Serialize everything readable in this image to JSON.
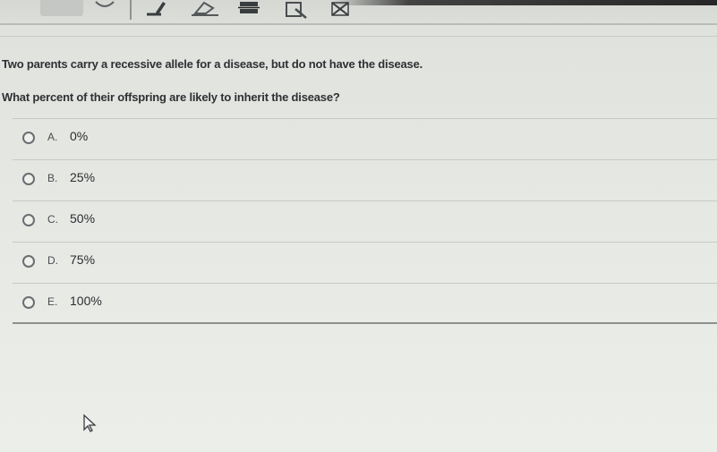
{
  "toolbar": {
    "icons": [
      "toolbar-tab",
      "chevron-down-icon",
      "highlighter-icon",
      "eraser-icon",
      "strikethrough-icon",
      "zoom-icon",
      "eliminate-choice-icon"
    ]
  },
  "question": {
    "line1": "Two parents carry a recessive allele for a disease, but do not have the disease.",
    "line2": "What percent of their offspring are likely to inherit the disease?"
  },
  "choices": [
    {
      "letter": "A.",
      "text": "0%"
    },
    {
      "letter": "B.",
      "text": "25%"
    },
    {
      "letter": "C.",
      "text": "50%"
    },
    {
      "letter": "D.",
      "text": "75%"
    },
    {
      "letter": "E.",
      "text": "100%"
    }
  ],
  "colors": {
    "background": "#e6e8e4",
    "text": "#2b2d30",
    "radio_border": "#6b6e71"
  }
}
